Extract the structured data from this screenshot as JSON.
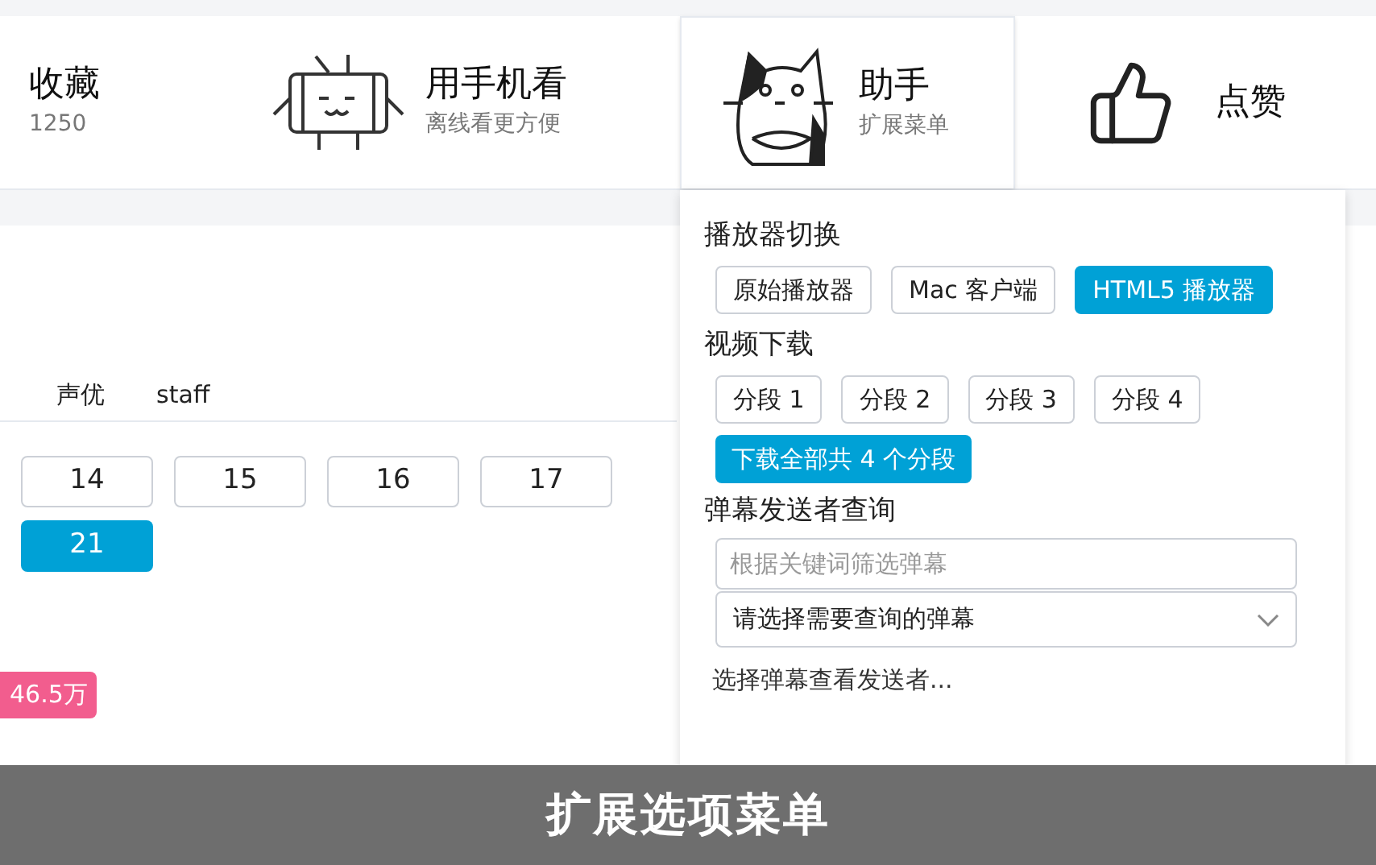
{
  "header": {
    "items": [
      {
        "kind": "plain",
        "title": "收藏",
        "subtitle": "1250",
        "selected": false
      },
      {
        "kind": "phone",
        "title": "用手机看",
        "subtitle": "离线看更方便",
        "selected": false
      },
      {
        "kind": "cat",
        "title": "助手",
        "subtitle": "扩展菜单",
        "selected": true
      },
      {
        "kind": "thumb",
        "title": "点赞",
        "selected": false
      }
    ]
  },
  "info_tabs": [
    "声优",
    "staff"
  ],
  "episodes": [
    {
      "label": "14",
      "selected": false
    },
    {
      "label": "15",
      "selected": false
    },
    {
      "label": "16",
      "selected": false
    },
    {
      "label": "17",
      "selected": false
    },
    {
      "label": "21",
      "selected": true
    }
  ],
  "play_count": "46.5万",
  "menu": {
    "sections": [
      {
        "title": "播放器切换",
        "buttons": [
          {
            "label": "原始播放器",
            "selected": false
          },
          {
            "label": "Mac 客户端",
            "selected": false
          },
          {
            "label": "HTML5 播放器",
            "selected": true
          }
        ]
      },
      {
        "title": "视频下载",
        "buttons": [
          {
            "label": "分段 1",
            "selected": false
          },
          {
            "label": "分段 2",
            "selected": false
          },
          {
            "label": "分段 3",
            "selected": false
          },
          {
            "label": "分段 4",
            "selected": false
          }
        ],
        "action": "下载全部共 4 个分段"
      },
      {
        "title": "弹幕发送者查询",
        "filter": {
          "placeholder": "根据关键词筛选弹幕"
        },
        "select": {
          "value": "请选择需要查询的弹幕"
        },
        "hint": "选择弹幕查看发送者..."
      }
    ]
  },
  "caption": "扩展选项菜单"
}
